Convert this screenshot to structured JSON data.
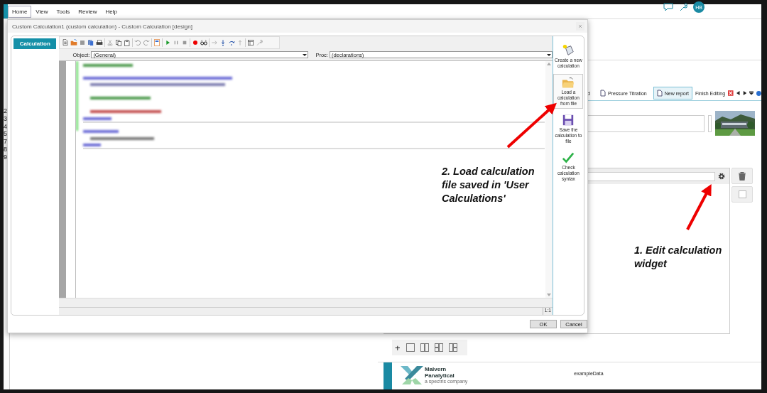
{
  "menu": [
    {
      "label": "Home",
      "selected": true
    },
    {
      "label": "View",
      "selected": false
    },
    {
      "label": "Tools",
      "selected": false
    },
    {
      "label": "Review",
      "selected": false
    },
    {
      "label": "Help",
      "selected": false
    }
  ],
  "user": {
    "initials": "HB"
  },
  "line_numbers": [
    "2",
    "3",
    "4",
    "5",
    "7",
    "8",
    "9"
  ],
  "report_tabs": [
    {
      "label": "d",
      "selected": false
    },
    {
      "label": "Pressure Titration",
      "selected": false
    },
    {
      "label": "New report",
      "selected": true
    }
  ],
  "finish_editing": "Finish Editing",
  "add_label": "+",
  "footer": {
    "brand_line1": "Malvern",
    "brand_line2": "Panalytical",
    "tagline": "a spectris company",
    "file": "exampleData"
  },
  "dialog": {
    "title": "Custom Calculation1 (custom calculation) - Custom Calculation [design]",
    "nav": [
      {
        "label": "Calculation",
        "selected": true
      }
    ],
    "object_label": "Object:",
    "object_value": "(General)",
    "proc_label": "Proc:",
    "proc_value": "(declarations)",
    "position": "1:1",
    "actions": [
      {
        "kind": "new",
        "label": "Create a new calculation",
        "hovered": false
      },
      {
        "kind": "load",
        "label": "Load a calculation from file",
        "hovered": true
      },
      {
        "kind": "save",
        "label": "Save the calculation to file",
        "hovered": false
      },
      {
        "kind": "check",
        "label": "Check calculation syntax",
        "hovered": false
      }
    ],
    "buttons": [
      "OK",
      "Cancel"
    ]
  },
  "annotations": [
    {
      "text": "2. Load calculation file saved in 'User Calculations'"
    },
    {
      "text": "1. Edit calculation widget"
    }
  ]
}
